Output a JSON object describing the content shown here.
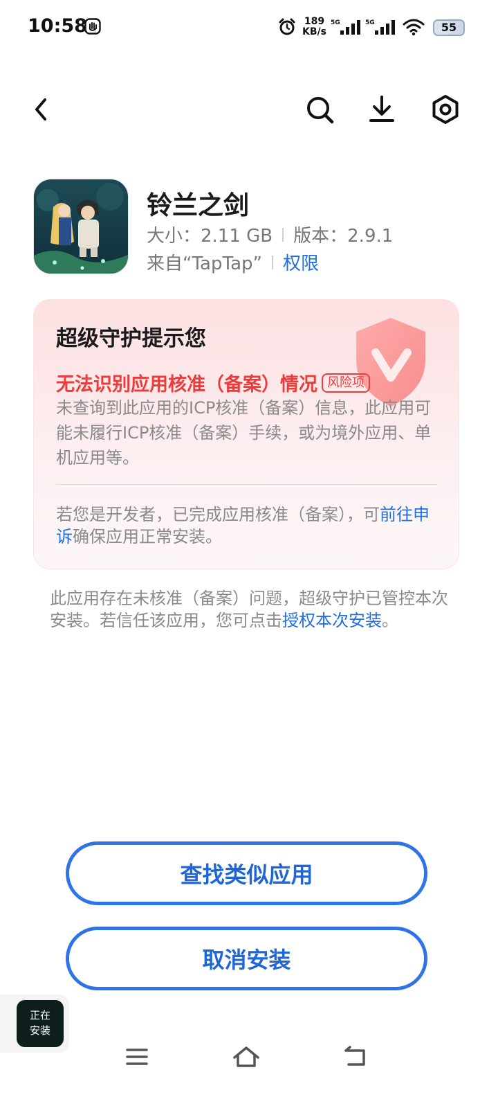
{
  "status_bar": {
    "time": "10:58",
    "net_speed_value": "189",
    "net_speed_unit": "KB/s",
    "signal1_label": "5G",
    "signal2_label": "5G",
    "battery": "55",
    "icons": [
      "hand-icon",
      "alarm-icon",
      "signal-icon",
      "signal-icon",
      "wifi-icon",
      "battery-icon"
    ]
  },
  "toolbar": {
    "icons": [
      "back-icon",
      "search-icon",
      "download-icon",
      "settings-icon"
    ]
  },
  "app": {
    "name": "铃兰之剑",
    "size_label": "大小：2.11 GB",
    "version_label": "版本：2.9.1",
    "source_label": "来自“TapTap”",
    "permissions_link": "权限"
  },
  "guard": {
    "title": "超级守护提示您",
    "risk_title": "无法识别应用核准（备案）情况",
    "risk_badge": "风险项",
    "risk_description": "未查询到此应用的ICP核准（备案）信息，此应用可能未履行ICP核准（备案）手续，或为境外应用、单机应用等。",
    "dev_note_prefix": "若您是开发者，已完成应用核准（备案），可",
    "dev_note_link": "前往申诉",
    "dev_note_suffix": "确保应用正常安装。",
    "shield_icon": "shield-check-icon",
    "accent_color": "#ec3b3b"
  },
  "footer_note": {
    "text": "此应用存在未核准（备案）问题，超级守护已管控本次安装。若信任该应用，您可点击",
    "link": "授权本次安装",
    "end": "。"
  },
  "buttons": {
    "find_similar": "查找类似应用",
    "cancel_install": "取消安装",
    "accent_color": "#2e74e6"
  },
  "installing_badge": {
    "line1": "正在",
    "line2": "安装"
  },
  "nav": {
    "icons": [
      "menu-icon",
      "home-icon",
      "back-icon"
    ]
  }
}
